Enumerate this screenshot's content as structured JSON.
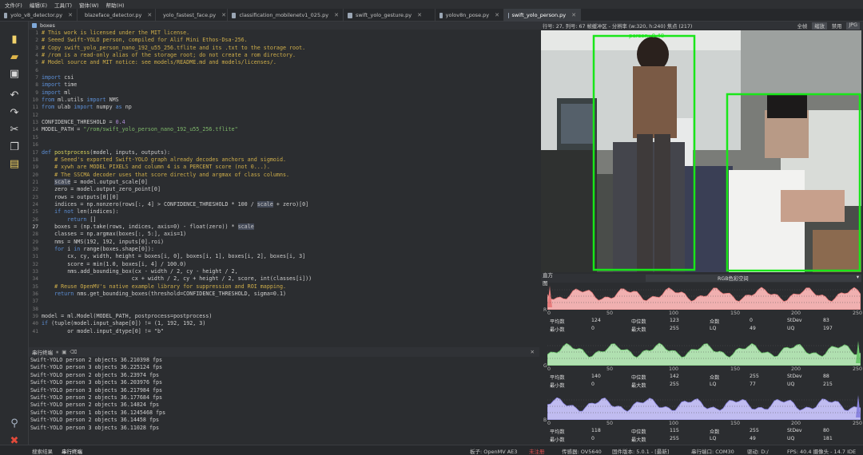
{
  "menu": [
    "文件(F)",
    "编辑(E)",
    "工具(T)",
    "窗体(W)",
    "帮助(H)"
  ],
  "tabs": [
    "yolo_v8_detector.py",
    "blazeface_detector.py",
    "yolo_fastest_face.py",
    "classification_mobilenetv1_025.py",
    "swift_yolo_gesture.py",
    "yolov8n_pose.py",
    "swift_yolo_person.py"
  ],
  "active_tab": 6,
  "breadcrumb": "boxes",
  "editor": {
    "line_numbers": [
      "1",
      "2",
      "3",
      "4",
      "5",
      "6",
      "7",
      "8",
      "9",
      "10",
      "11",
      "12",
      "13",
      "14",
      "15",
      "16",
      "17",
      "18",
      "19",
      "20",
      "21",
      "22",
      "23",
      "24",
      "25",
      "26",
      "27",
      "28",
      "29",
      "30",
      "31",
      "32",
      "33",
      "34",
      "35",
      "36",
      "37",
      "38",
      "39",
      "40",
      "41"
    ],
    "lines": [
      [
        {
          "c": "cm",
          "t": "# This work is licensed under the MIT license."
        }
      ],
      [
        {
          "c": "cm",
          "t": "# Seeed Swift-YOLO person, compiled for Alif Mini Ethos-Dsa-256."
        }
      ],
      [
        {
          "c": "cm",
          "t": "# Copy swift_yolo_person_nano_192_u55_256.tflite and its .txt to the storage root."
        }
      ],
      [
        {
          "c": "cm",
          "t": "# /rom is a read-only alias of the storage root; do not create a rom directory."
        }
      ],
      [
        {
          "c": "cm",
          "t": "# Model source and MIT notice: see models/README.md and models/licenses/."
        }
      ],
      [],
      [
        {
          "c": "kw",
          "t": "import"
        },
        {
          "c": "pl",
          "t": " csi"
        }
      ],
      [
        {
          "c": "kw",
          "t": "import"
        },
        {
          "c": "pl",
          "t": " time"
        }
      ],
      [
        {
          "c": "kw",
          "t": "import"
        },
        {
          "c": "pl",
          "t": " ml"
        }
      ],
      [
        {
          "c": "kw",
          "t": "from"
        },
        {
          "c": "pl",
          "t": " ml.utils "
        },
        {
          "c": "kw",
          "t": "import"
        },
        {
          "c": "pl",
          "t": " NMS"
        }
      ],
      [
        {
          "c": "kw",
          "t": "from"
        },
        {
          "c": "pl",
          "t": " ulab "
        },
        {
          "c": "kw",
          "t": "import"
        },
        {
          "c": "pl",
          "t": " numpy "
        },
        {
          "c": "kw",
          "t": "as"
        },
        {
          "c": "pl",
          "t": " np"
        }
      ],
      [],
      [
        {
          "c": "pl",
          "t": "CONFIDENCE_THRESHOLD = "
        },
        {
          "c": "nm",
          "t": "0.4"
        }
      ],
      [
        {
          "c": "pl",
          "t": "MODEL_PATH = "
        },
        {
          "c": "st",
          "t": "\"/rom/swift_yolo_person_nano_192_u55_256.tflite\""
        }
      ],
      [],
      [],
      [
        {
          "c": "kw",
          "t": "def"
        },
        {
          "c": "pl",
          "t": " "
        },
        {
          "c": "fn",
          "t": "postprocess"
        },
        {
          "c": "pl",
          "t": "(model, inputs, outputs):"
        }
      ],
      [
        {
          "c": "cm",
          "t": "    # Seeed's exported Swift-YOLO graph already decodes anchors and sigmoid."
        }
      ],
      [
        {
          "c": "cm",
          "t": "    # xywh are MODEL PIXELS and column 4 is a PERCENT score (not 0...)."
        }
      ],
      [
        {
          "c": "cm",
          "t": "    # The SSCMA decoder uses that score directly and argmax of class columns."
        }
      ],
      [
        {
          "c": "pl",
          "t": "    "
        },
        {
          "c": "hl",
          "t": "scale"
        },
        {
          "c": "pl",
          "t": " = model.output_scale[0]"
        }
      ],
      [
        {
          "c": "pl",
          "t": "    zero = model.output_zero_point[0]"
        }
      ],
      [
        {
          "c": "pl",
          "t": "    rows = outputs[0][0]"
        }
      ],
      [
        {
          "c": "pl",
          "t": "    indices = np.nonzero(rows[:, 4] > CONFIDENCE_THRESHOLD * 100 / "
        },
        {
          "c": "hl",
          "t": "scale"
        },
        {
          "c": "pl",
          "t": " + zero)[0]"
        }
      ],
      [
        {
          "c": "kw",
          "t": "    if not"
        },
        {
          "c": "pl",
          "t": " len(indices):"
        }
      ],
      [
        {
          "c": "kw",
          "t": "        return"
        },
        {
          "c": "pl",
          "t": " []"
        }
      ],
      [
        {
          "c": "pl",
          "t": "    boxes = (np.take(rows, indices, axis=0) - float(zero)) * "
        },
        {
          "c": "hl",
          "t": "scale"
        }
      ],
      [
        {
          "c": "pl",
          "t": "    classes = np.argmax(boxes[:, 5:], axis=1)"
        }
      ],
      [
        {
          "c": "pl",
          "t": "    nms = NMS(192, 192, inputs[0].roi)"
        }
      ],
      [
        {
          "c": "kw",
          "t": "    for"
        },
        {
          "c": "pl",
          "t": " i "
        },
        {
          "c": "kw",
          "t": "in"
        },
        {
          "c": "pl",
          "t": " range(boxes.shape[0]):"
        }
      ],
      [
        {
          "c": "pl",
          "t": "        cx, cy, width, height = boxes[i, 0], boxes[i, 1], boxes[i, 2], boxes[i, 3]"
        }
      ],
      [
        {
          "c": "pl",
          "t": "        score = min(1.0, boxes[i, 4] / 100.0)"
        }
      ],
      [
        {
          "c": "pl",
          "t": "        nms.add_bounding_box(cx - width / 2, cy - height / 2,"
        }
      ],
      [
        {
          "c": "pl",
          "t": "                            cx + width / 2, cy + height / 2, score, int(classes[i]))"
        }
      ],
      [
        {
          "c": "cm",
          "t": "    # Reuse OpenMV's native example library for suppression and ROI mapping."
        }
      ],
      [
        {
          "c": "kw",
          "t": "    return"
        },
        {
          "c": "pl",
          "t": " nms.get_bounding_boxes(threshold=CONFIDENCE_THRESHOLD, sigma=0.1)"
        }
      ],
      [],
      [],
      [
        {
          "c": "pl",
          "t": "model = ml.Model(MODEL_PATH, postprocess=postprocess)"
        }
      ],
      [
        {
          "c": "kw",
          "t": "if"
        },
        {
          "c": "pl",
          "t": " (tuple(model.input_shape[0]) != (1, 192, 192, 3)"
        }
      ],
      [
        {
          "c": "pl",
          "t": "        or model.input_dtype[0] != \"b\""
        }
      ]
    ]
  },
  "frame_info": "行号: 27, 列号: 67  帧缓冲区 - 分辨率 (w:320, h:240)  焦点 (217)",
  "frame_buttons": [
    "全帧",
    "缩放",
    "禁用",
    "JPG"
  ],
  "detection_label": "person: 0.48",
  "histogram": {
    "title": "直方图",
    "colorspace": "RGB色彩空间",
    "ticks": [
      "0",
      "50",
      "100",
      "150",
      "200",
      "250"
    ],
    "channels": [
      {
        "label": "R",
        "color": "#e87c7c",
        "fill": "#f0b0b0",
        "row1": [
          "平均数",
          "124",
          "中位数",
          "123",
          "众数",
          "0",
          "StDev",
          "83"
        ],
        "row2": [
          "最小数",
          "0",
          "最大数",
          "255",
          "LQ",
          "49",
          "UQ",
          "197"
        ]
      },
      {
        "label": "G",
        "color": "#6cc86c",
        "fill": "#b0e0b0",
        "row1": [
          "平均数",
          "140",
          "中位数",
          "142",
          "众数",
          "255",
          "StDev",
          "88"
        ],
        "row2": [
          "最小数",
          "0",
          "最大数",
          "255",
          "LQ",
          "77",
          "UQ",
          "215"
        ]
      },
      {
        "label": "B",
        "color": "#8a84e0",
        "fill": "#c0bcf0",
        "row1": [
          "平均数",
          "118",
          "中位数",
          "115",
          "众数",
          "255",
          "StDev",
          "80"
        ],
        "row2": [
          "最小数",
          "0",
          "最大数",
          "255",
          "LQ",
          "49",
          "UQ",
          "181"
        ]
      }
    ]
  },
  "terminal": {
    "title": "串行终端",
    "lines": [
      "Swift-YOLO person 2 objects 36.210398 fps",
      "Swift-YOLO person 3 objects 36.225124 fps",
      "Swift-YOLO person 2 objects 36.23974 fps",
      "Swift-YOLO person 3 objects 36.203976 fps",
      "Swift-YOLO person 3 objects 36.217984 fps",
      "Swift-YOLO person 2 objects 36.177684 fps",
      "Swift-YOLO person 2 objects 36.14824 fps",
      "Swift-YOLO person 1 objects 36.1245468 fps",
      "Swift-YOLO person 2 objects 36.14458 fps",
      "Swift-YOLO person 3 objects 36.11028 fps"
    ]
  },
  "bottom_tabs": [
    "搜索结果",
    "串行终端"
  ],
  "status": {
    "board": "板子: OpenMV AE3",
    "unreg": "未注册",
    "sensor": "传感器: OV5640",
    "firmware": "固件版本: 5.0.1 - [最新]",
    "port": "串行端口: COM30",
    "drive": "驱动: D:/",
    "fps": "FPS: 40.4 摄像头 - 14.7 IDE"
  }
}
